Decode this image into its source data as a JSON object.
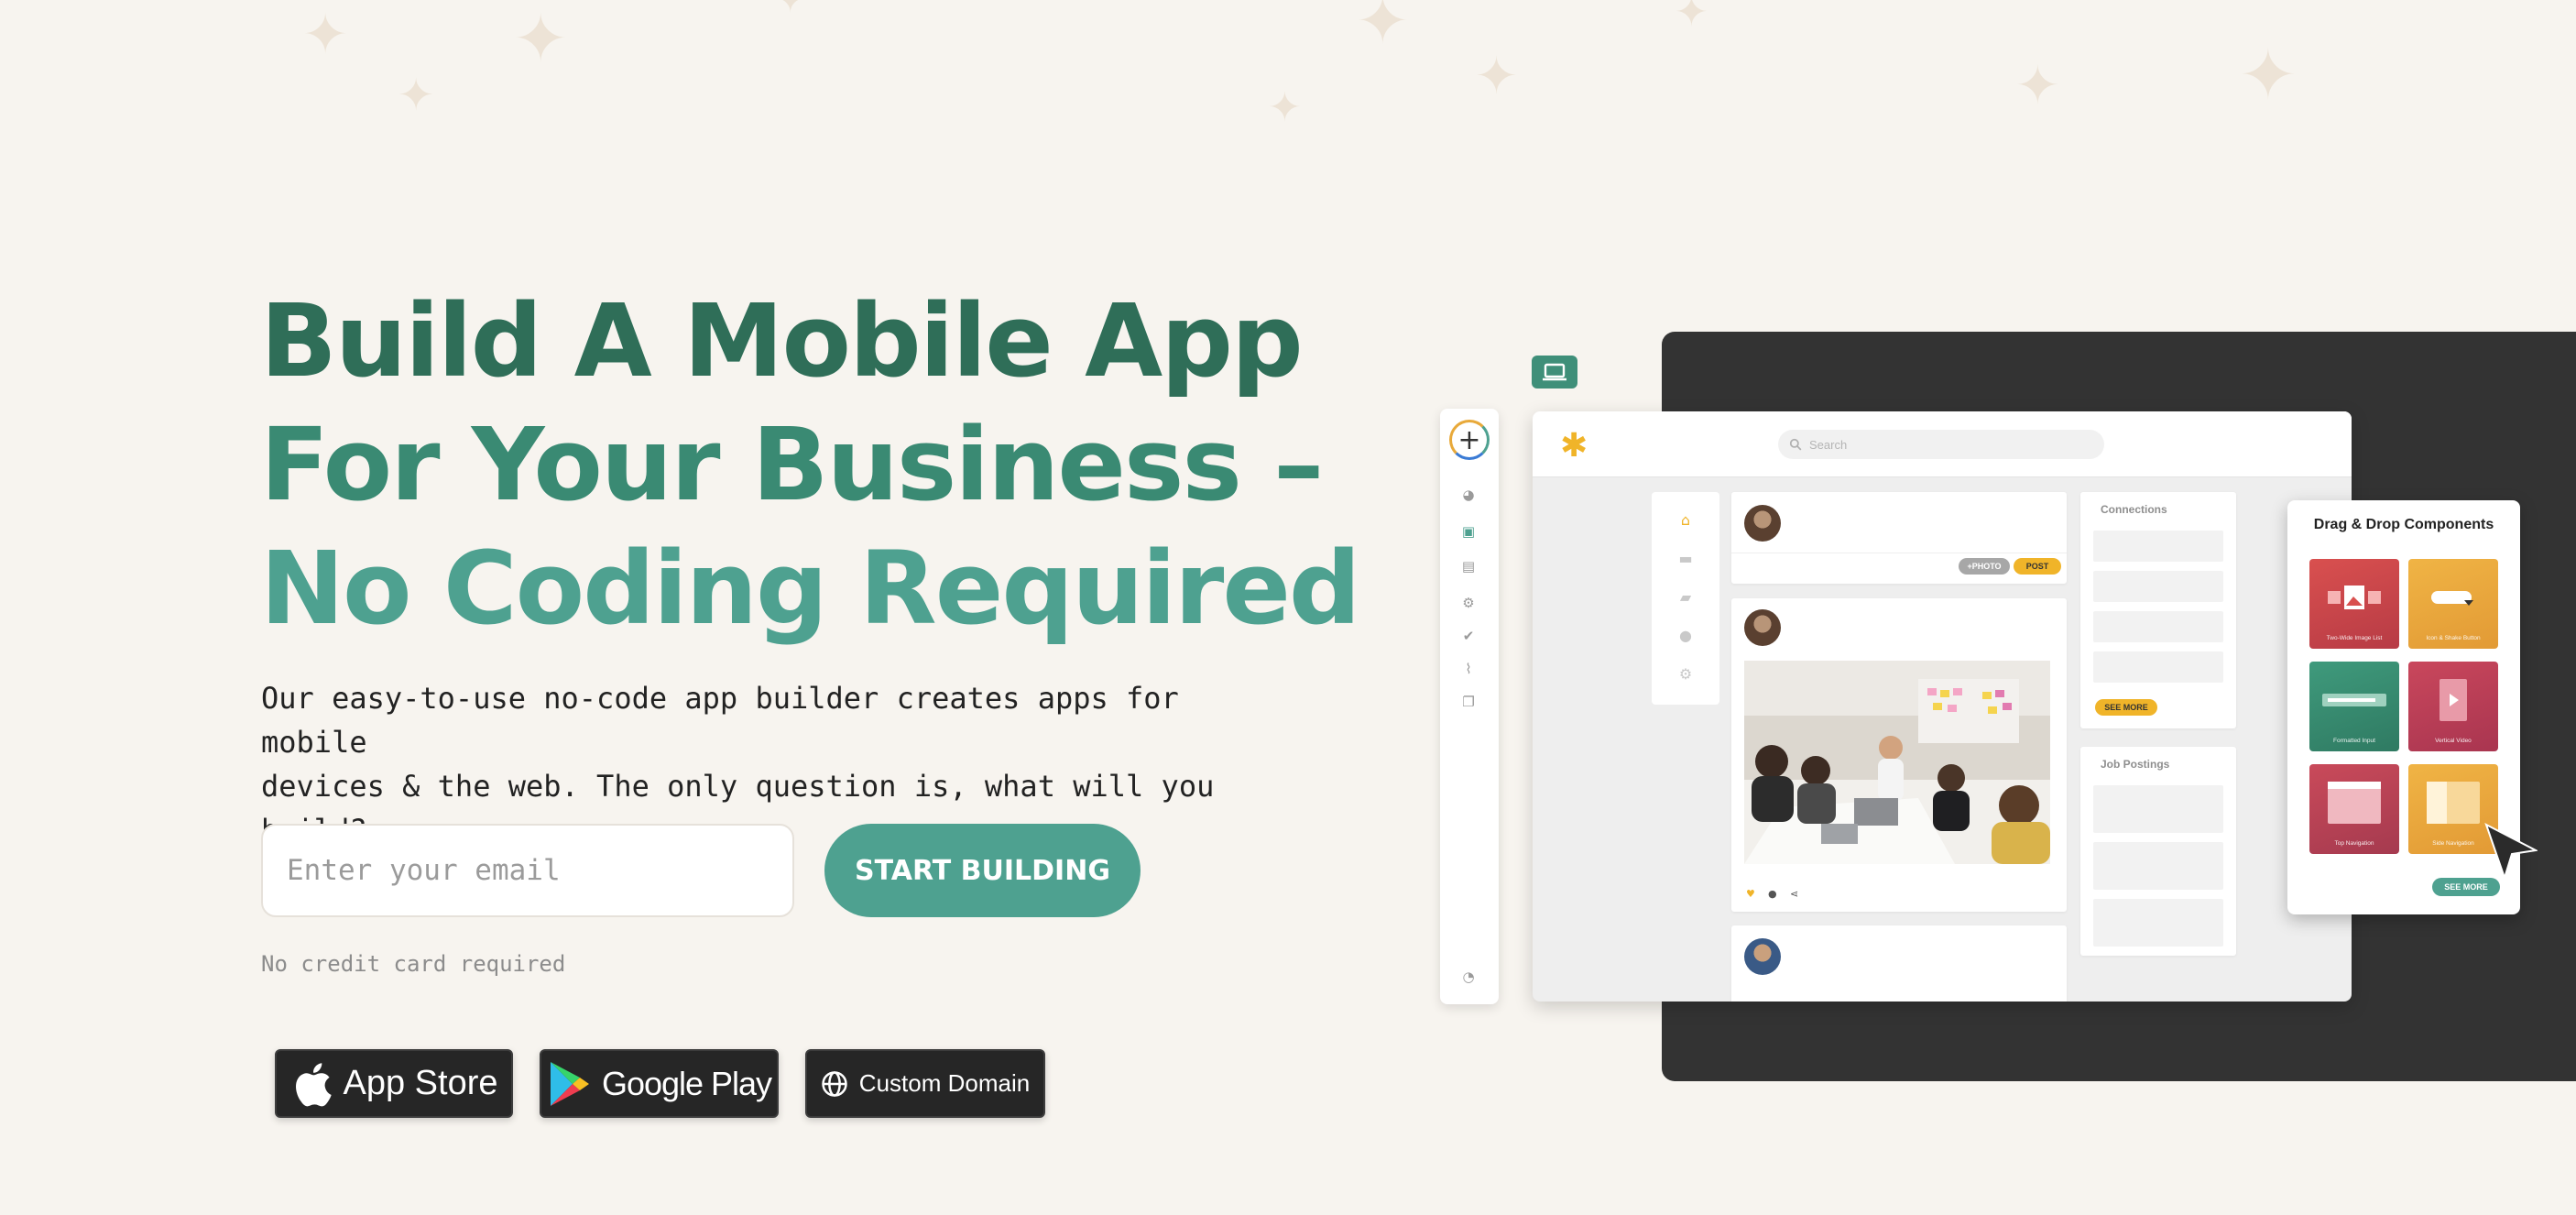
{
  "hero": {
    "title_line1": "Build A Mobile App",
    "title_line2": "For Your Business –",
    "title_line3": "No Coding Required",
    "subtitle_line1": "Our easy-to-use no-code app builder creates apps for mobile",
    "subtitle_line2": "devices & the web. The only question is, what will you build?",
    "email_placeholder": "Enter your email",
    "cta_label": "START BUILDING",
    "note": "No credit card required"
  },
  "badges": {
    "app_store": "App Store",
    "google_play": "Google Play",
    "custom_domain": "Custom Domain"
  },
  "mockup": {
    "search_placeholder": "Search",
    "photo_pill": "+PHOTO",
    "post_pill": "POST",
    "connections_title": "Connections",
    "see_more": "SEE MORE",
    "job_postings_title": "Job Postings",
    "dnd_title": "Drag & Drop Components",
    "dnd_see_more": "SEE MORE",
    "tiles": [
      "Two-Wide Image List",
      "Icon & Shake Button",
      "Formatted Input",
      "Vertical Video",
      "Top Navigation",
      "Side Navigation"
    ]
  },
  "colors": {
    "accent": "#4ea190",
    "title_dark": "#2f6e58",
    "background": "#f7f4ef",
    "panel_dark": "#333333"
  }
}
